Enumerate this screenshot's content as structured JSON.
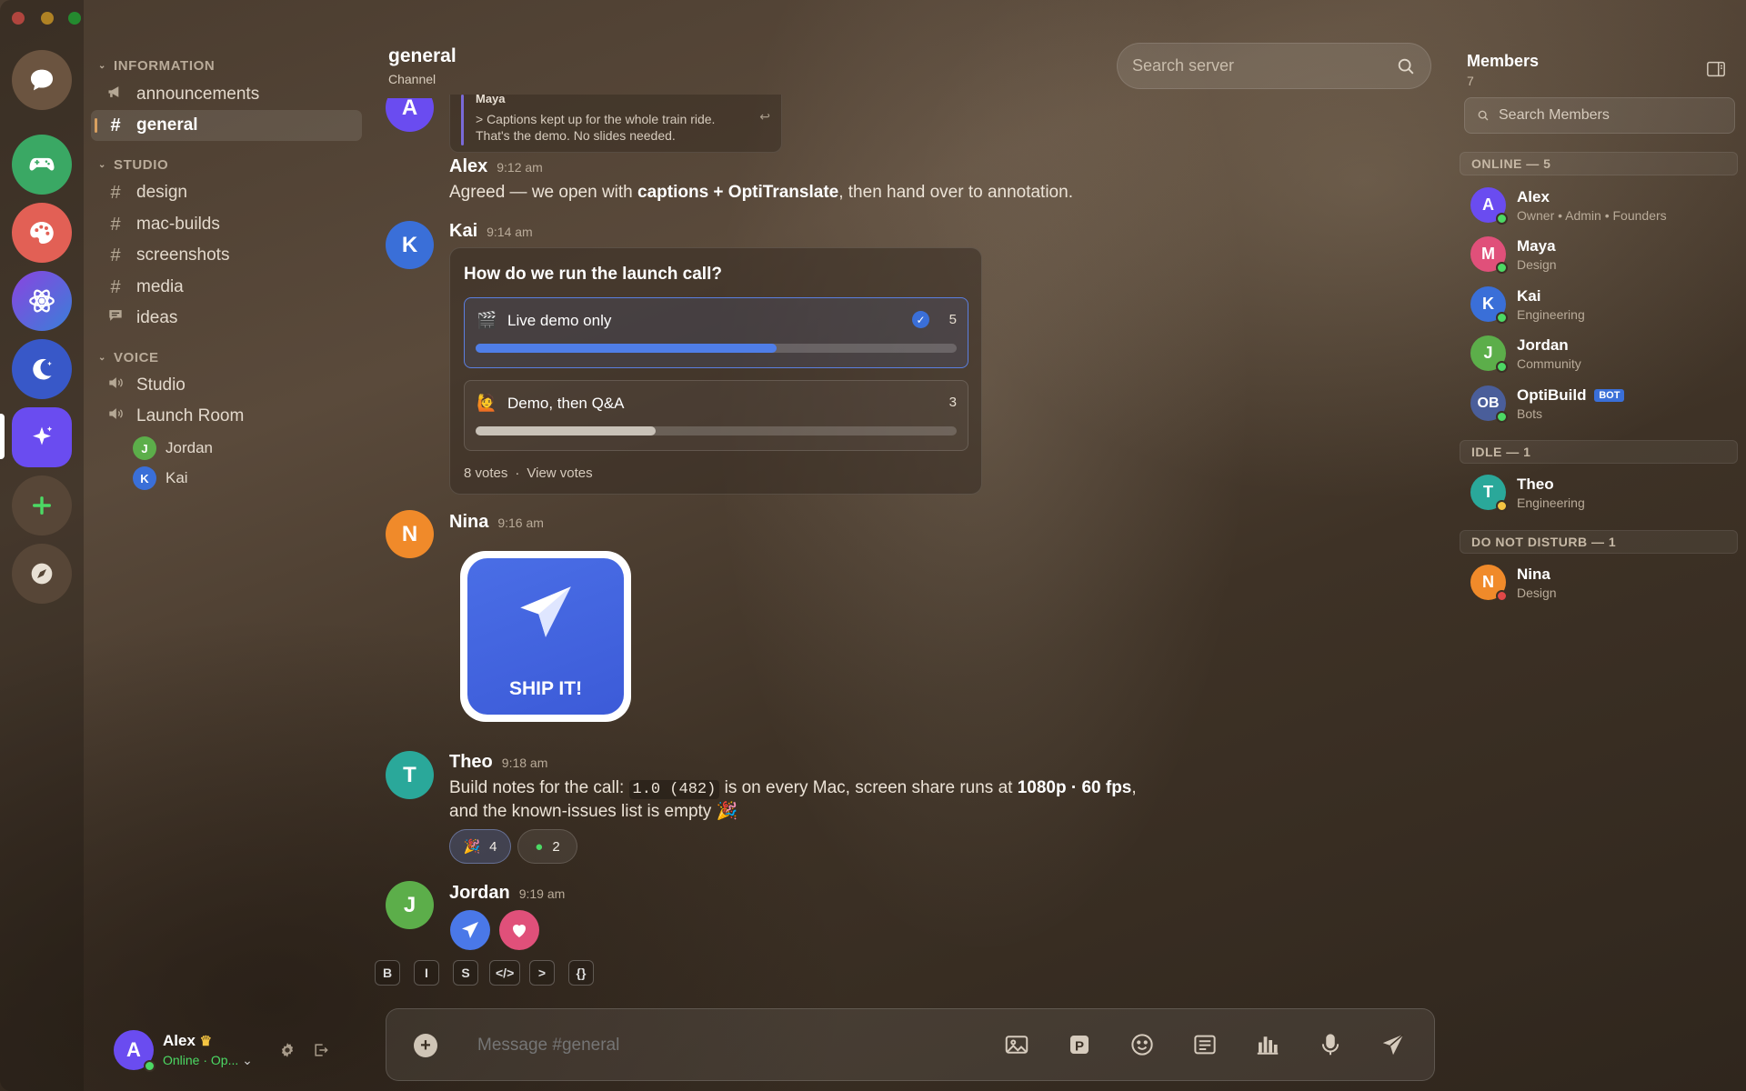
{
  "window": {
    "traffic_lights": [
      "#ff5f57",
      "#febc2e",
      "#28c840"
    ]
  },
  "servers": [
    {
      "name": "chat-bubble-icon",
      "color": "#6b5440"
    },
    {
      "name": "gamepad-icon",
      "color": "#3aa864"
    },
    {
      "name": "palette-icon",
      "color": "#e26055"
    },
    {
      "name": "atom-icon",
      "color": "#7050d0"
    },
    {
      "name": "moon-icon",
      "color": "#3858c8"
    },
    {
      "name": "sparkle-icon",
      "color": "#6a4cf0",
      "selected": true
    },
    {
      "name": "plus-icon",
      "color": "#554535"
    },
    {
      "name": "compass-icon",
      "color": "#554535"
    }
  ],
  "channels": {
    "information_label": "INFORMATION",
    "announcements": "announcements",
    "general": "general",
    "studio_label": "STUDIO",
    "studio": [
      "design",
      "mac-builds",
      "screenshots",
      "media"
    ],
    "ideas": "ideas",
    "voice_label": "VOICE",
    "voice_studio": "Studio",
    "voice_launch": "Launch Room",
    "voice_users": [
      {
        "initial": "J",
        "name": "Jordan",
        "color": "#5cae4a"
      },
      {
        "initial": "K",
        "name": "Kai",
        "color": "#3a6fd8"
      }
    ]
  },
  "user_panel": {
    "initial": "A",
    "name": "Alex",
    "crown": "♛",
    "status": "Online · Op...",
    "status_color": "#4cd964"
  },
  "header": {
    "title": "general",
    "subtitle": "Channel",
    "search_placeholder": "Search server"
  },
  "messages": {
    "quote": {
      "author_initial": "A",
      "author": "Maya",
      "line1": "> Captions kept up for the whole train ride.",
      "line2": "That's the demo. No slides needed.",
      "reply_glyph": "↩"
    },
    "alex": {
      "name": "Alex",
      "time": "9:12 am",
      "t1": "Agreed — we open with ",
      "bold": "captions + OptiTranslate",
      "t2": ", then hand over to annotation."
    },
    "kai": {
      "initial": "K",
      "name": "Kai",
      "time": "9:14 am",
      "color": "#3a6fd8"
    },
    "nina": {
      "initial": "N",
      "name": "Nina",
      "time": "9:16 am",
      "color": "#f08a2a",
      "sticker_text": "SHIP IT!"
    },
    "theo": {
      "initial": "T",
      "name": "Theo",
      "time": "9:18 am",
      "color": "#2aa89a",
      "t1": "Build notes for the call: ",
      "code": "1.0 (482)",
      "t2": " is on every Mac, screen share runs at ",
      "bold": "1080p · 60 fps",
      "t3": ",",
      "line2": "and the known-issues list is empty 🎉",
      "reactions": [
        {
          "emoji": "🎉",
          "count": "4"
        },
        {
          "emoji": "●",
          "count": "2"
        }
      ]
    },
    "jordan": {
      "initial": "J",
      "name": "Jordan",
      "time": "9:19 am",
      "color": "#5cae4a"
    }
  },
  "poll": {
    "question": "How do we run the launch call?",
    "options": [
      {
        "emoji": "🎬",
        "label": "Live demo only",
        "votes": "5",
        "fraction": 0.625,
        "selected": true
      },
      {
        "emoji": "🙋",
        "label": "Demo, then Q&A",
        "votes": "3",
        "fraction": 0.375,
        "selected": false
      }
    ],
    "total": "8 votes",
    "sep": "·",
    "view": "View votes"
  },
  "format_bar": [
    "B",
    "I",
    "S",
    "</>",
    ">",
    "{}"
  ],
  "composer": {
    "placeholder": "Message #general",
    "tools": [
      "image-icon",
      "p-icon",
      "emoji-icon",
      "sticker-icon",
      "poll-chart-icon",
      "mic-icon",
      "send-icon"
    ]
  },
  "members": {
    "title": "Members",
    "count": "7",
    "search_placeholder": "Search Members",
    "online_label": "ONLINE — 5",
    "online": [
      {
        "initial": "A",
        "name": "Alex",
        "role": "Owner • Admin • Founders",
        "color": "#6a4cf0"
      },
      {
        "initial": "M",
        "name": "Maya",
        "role": "Design",
        "color": "#e0507a"
      },
      {
        "initial": "K",
        "name": "Kai",
        "role": "Engineering",
        "color": "#3a6fd8"
      },
      {
        "initial": "J",
        "name": "Jordan",
        "role": "Community",
        "color": "#5cae4a"
      },
      {
        "initial": "OB",
        "name": "OptiBuild",
        "role": "Bots",
        "color": "#4a5e9a",
        "badge": "BOT"
      }
    ],
    "idle_label": "IDLE — 1",
    "idle": {
      "initial": "T",
      "name": "Theo",
      "role": "Engineering",
      "color": "#2aa89a"
    },
    "dnd_label": "DO NOT DISTURB — 1",
    "dnd": {
      "initial": "N",
      "name": "Nina",
      "role": "Design",
      "color": "#f08a2a"
    }
  }
}
